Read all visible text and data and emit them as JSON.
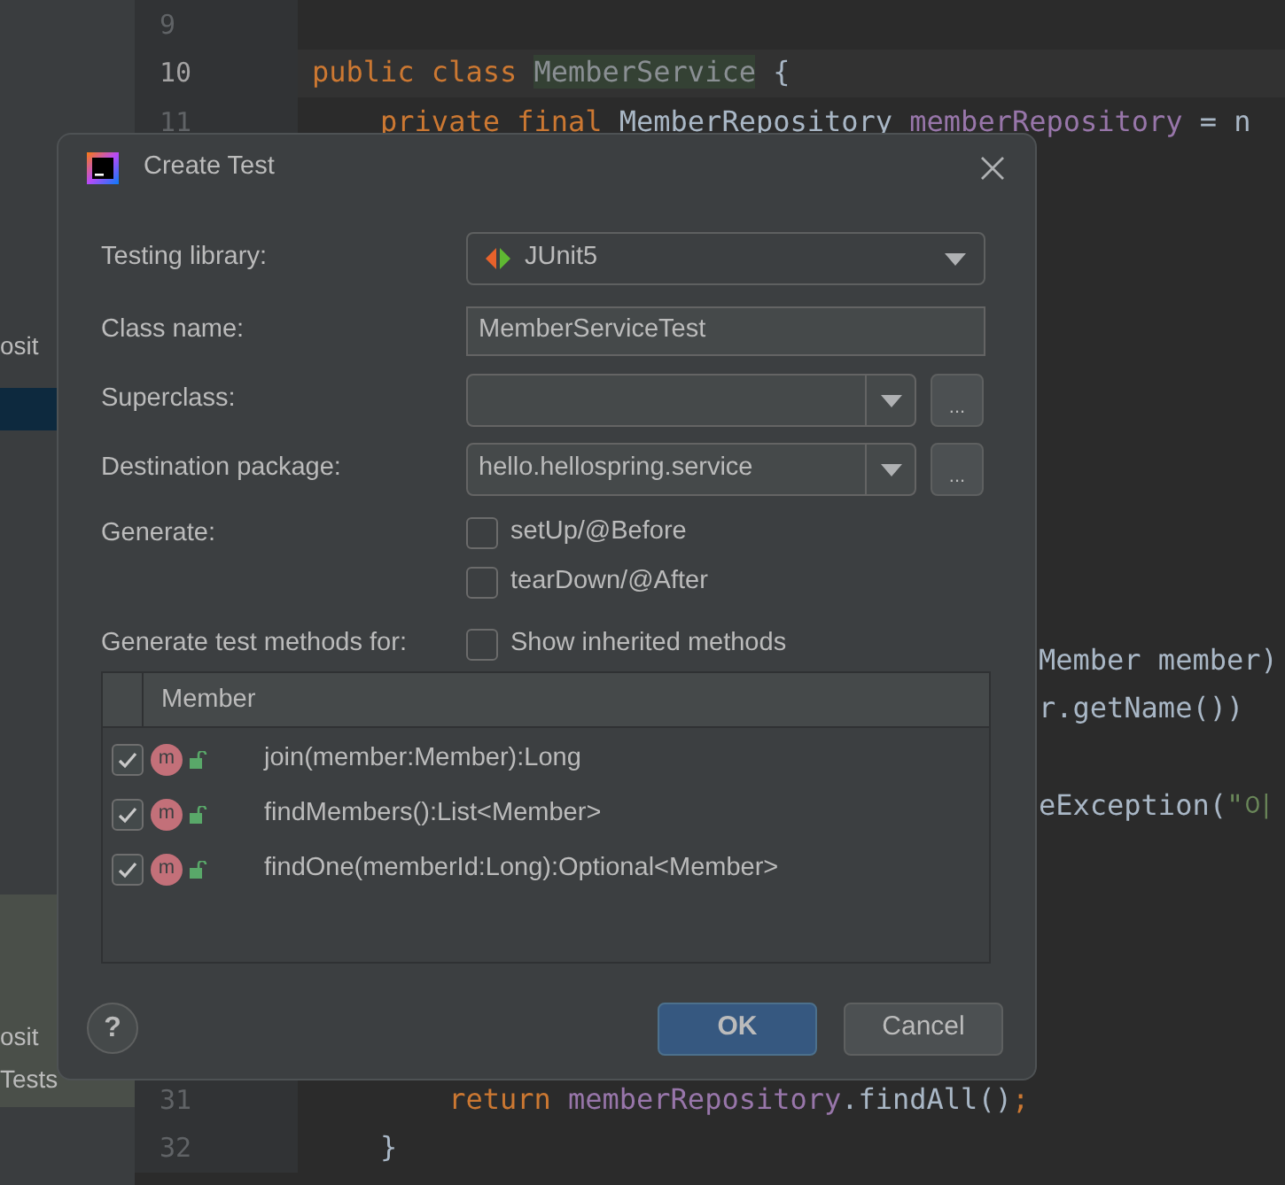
{
  "editor": {
    "sidebar_items": [
      {
        "label": "osit"
      },
      {
        "label": "osit"
      },
      {
        "label": "Tests"
      }
    ],
    "lines": [
      {
        "number": "9",
        "current": false
      },
      {
        "number": "10",
        "current": true,
        "tokens": [
          {
            "text": "public class ",
            "kind": "keyword"
          },
          {
            "text": "MemberService",
            "kind": "highlight"
          },
          {
            "text": " {",
            "kind": "plain"
          }
        ]
      },
      {
        "number": "11",
        "current": false,
        "tokens": [
          {
            "text": "    private final ",
            "kind": "keyword"
          },
          {
            "text": "MemberRepository ",
            "kind": "plain"
          },
          {
            "text": "memberRepository",
            "kind": "field"
          },
          {
            "text": " = n",
            "kind": "plain"
          }
        ]
      },
      {
        "tokens": [
          {
            "text": "Member member)",
            "kind": "plain"
          }
        ]
      },
      {
        "tokens": [
          {
            "text": "r.getName())",
            "kind": "plain"
          }
        ]
      },
      {
        "tokens": [
          {
            "text": "eException(",
            "kind": "plain"
          },
          {
            "text": "\"이",
            "kind": "string"
          }
        ]
      },
      {
        "number": "31",
        "current": false,
        "tokens": [
          {
            "text": "        return ",
            "kind": "keyword"
          },
          {
            "text": "memberRepository",
            "kind": "field"
          },
          {
            "text": ".findAll()",
            "kind": "plain"
          },
          {
            "text": ";",
            "kind": "keyword"
          }
        ]
      },
      {
        "number": "32",
        "current": false,
        "tokens": [
          {
            "text": "    }",
            "kind": "plain"
          }
        ]
      }
    ]
  },
  "dialog": {
    "title": "Create Test",
    "fields": [
      {
        "label": "Testing library:",
        "kind": "library",
        "value": "JUnit5"
      },
      {
        "label": "Class name:",
        "kind": "text",
        "value": "MemberServiceTest"
      },
      {
        "label": "Superclass:",
        "kind": "combo",
        "browse": "..."
      },
      {
        "label": "Destination package:",
        "kind": "combo",
        "value": "hello.hellospring.service",
        "browse": "..."
      }
    ],
    "generate_label": "Generate:",
    "generate_options": [
      {
        "label": "setUp/@Before",
        "checked": false
      },
      {
        "label": "tearDown/@After",
        "checked": false
      }
    ],
    "methods_label": "Generate test methods for:",
    "show_inherited": {
      "label": "Show inherited methods",
      "checked": false
    },
    "table": {
      "column": "Member",
      "rows": [
        {
          "method": "join(member:Member):Long",
          "checked": true,
          "badge": "m"
        },
        {
          "method": "findMembers():List<Member>",
          "checked": true,
          "badge": "m"
        },
        {
          "method": "findOne(memberId:Long):Optional<Member>",
          "checked": true,
          "badge": "m"
        }
      ]
    },
    "help": "?",
    "buttons": [
      {
        "label": "OK",
        "default": true
      },
      {
        "label": "Cancel",
        "default": false
      }
    ]
  }
}
